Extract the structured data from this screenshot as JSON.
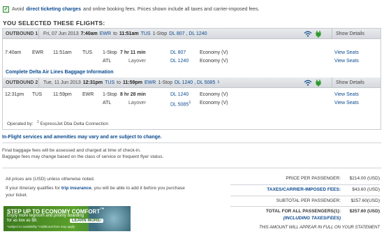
{
  "notice": {
    "lead": "Avoid",
    "link": "direct ticketing charges",
    "rest": "and online booking fees. Prices shown include all taxes and carrier-imposed fees."
  },
  "selected_title": "YOU SELECTED THESE FLIGHTS:",
  "outbound1": {
    "label": "OUTBOUND 1",
    "date": "Fri, 07 Jun 2013",
    "dep_time": "7:40am",
    "dep_code": "EWR",
    "to": "to",
    "arr_time": "11:51am",
    "arr_code": "TUS",
    "stops": "1-Stop",
    "flights": "DL 807 , DL 1240",
    "show_details": "Show Details",
    "rows": [
      {
        "dep": "7:40am",
        "from": "EWR",
        "arr": "11:51am",
        "to": "TUS",
        "stop": "1-Stop",
        "duration": "7 hr 11 min",
        "flight": "DL 807",
        "cabin": "Economy (V)",
        "action": "View Seats"
      },
      {
        "dep": "",
        "from": "",
        "arr": "",
        "to": "",
        "stop": "ATL",
        "duration": "Layover",
        "flight": "DL 1240",
        "cabin": "Economy (V)",
        "action": "View Seats"
      }
    ],
    "baggage": "Complete Delta Air Lines Baggage Information"
  },
  "outbound2": {
    "label": "OUTBOUND 2",
    "date": "Tue, 11 Jun 2013",
    "dep_time": "12:31pm",
    "dep_code": "TUS",
    "to": "to",
    "arr_time": "11:59pm",
    "arr_code": "EWR",
    "stops": "1-Stop",
    "flights": "DL 1240 , DL 5085",
    "sup": "1",
    "show_details": "Show Details",
    "rows": [
      {
        "dep": "12:31pm",
        "from": "TUS",
        "arr": "11:59pm",
        "to": "EWR",
        "stop": "1-Stop",
        "duration": "8 hr 28 min",
        "flight": "DL 1240",
        "cabin": "Economy (V)",
        "action": "View Seats"
      },
      {
        "dep": "",
        "from": "",
        "arr": "",
        "to": "",
        "stop": "ATL",
        "duration": "Layover",
        "flight": "DL 5085",
        "cabin": "Economy (V)",
        "action": "View Seats"
      }
    ],
    "operated_label": "Operated by:",
    "operated_sup": "1",
    "operated_value": "ExpressJet Dba Delta Connection"
  },
  "inflight_link": "In-Flight services and amenities may vary and are subject to change.",
  "bag_note_1": "Final baggage fees will be assessed and charged at time of check-in.",
  "bag_note_2": "Baggage fees may change based on the class of service or frequent flyer status.",
  "prices_note": "All prices are (USD) unless otherwise noted.",
  "insurance": {
    "pre": "If your itinerary qualifies for",
    "link": "trip insurance",
    "post": ", you will be able to add it before you purchase your ticket."
  },
  "fares": {
    "price_label": "PRICE PER PASSENGER:",
    "price_value": "$214.00 (USD)",
    "taxes_label": "TAXES/CARRIER-IMPOSED FEES:",
    "taxes_value": "$43.60 (USD)",
    "subtotal_label": "SUBTOTAL PER PASSENGER:",
    "subtotal_value": "$257.60(USD)",
    "total_label": "TOTAL FOR ALL PASSENGERS(1):",
    "total_value": "$257.60 (USD)",
    "incl": "(INCLUDING TAXES/FEES)",
    "statement": "THIS AMOUNT WILL APPEAR IN FULL ON YOUR STATEMENT"
  },
  "promo": {
    "headline": "STEP UP TO ECONOMY COMFORT",
    "tm": "™",
    "line1": "Enjoy more legroom and priority boarding",
    "line2": "for as low as $9.",
    "learn_more": "LEARN MORE›",
    "fine": "*subject to availability *Additional fees may apply"
  },
  "colors": {
    "link": "#0b4a8f",
    "bar": "#dfe2e5",
    "promo_green": "#4f8f25"
  }
}
